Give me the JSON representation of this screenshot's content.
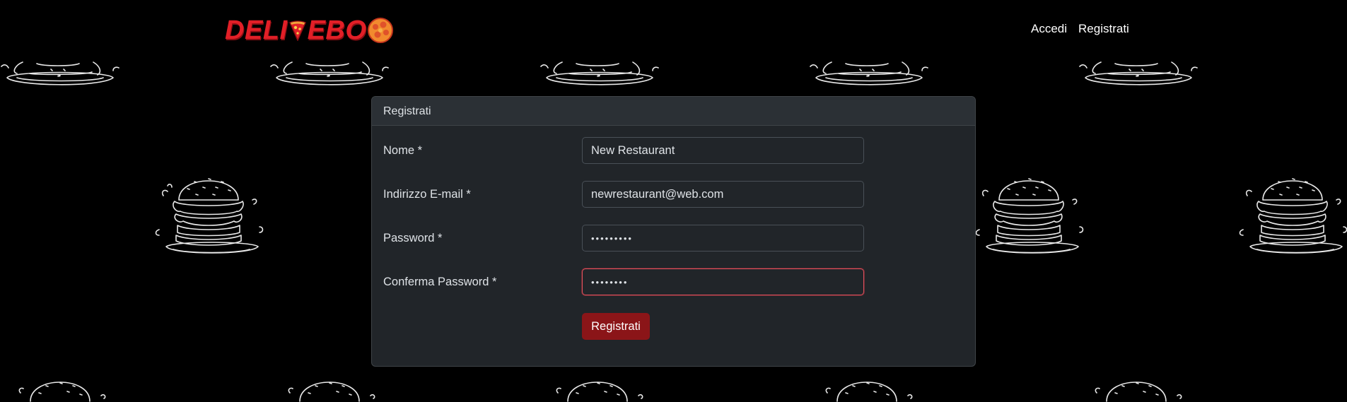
{
  "brand": {
    "logo_text_left": "DELI",
    "logo_text_right": "EBO",
    "colors": {
      "logo_red": "#e21f27",
      "burger_orange": "#f28a2e",
      "accent_button": "#8b1518",
      "focus_border": "#e0525d",
      "card_bg": "#212529",
      "page_bg": "#000000"
    },
    "icons": [
      "pizza-slice-icon",
      "burger-icon"
    ]
  },
  "nav": {
    "login_label": "Accedi",
    "register_label": "Registrati"
  },
  "form": {
    "title": "Registrati",
    "fields": [
      {
        "label": "Nome *",
        "value": "New Restaurant",
        "type": "text"
      },
      {
        "label": "Indirizzo E-mail *",
        "value": "newrestaurant@web.com",
        "type": "email"
      },
      {
        "label": "Password *",
        "value": "•••••••••",
        "type": "password"
      },
      {
        "label": "Conferma Password *",
        "value": "••••••••",
        "type": "password",
        "focused": true
      }
    ],
    "submit_label": "Registrati"
  }
}
